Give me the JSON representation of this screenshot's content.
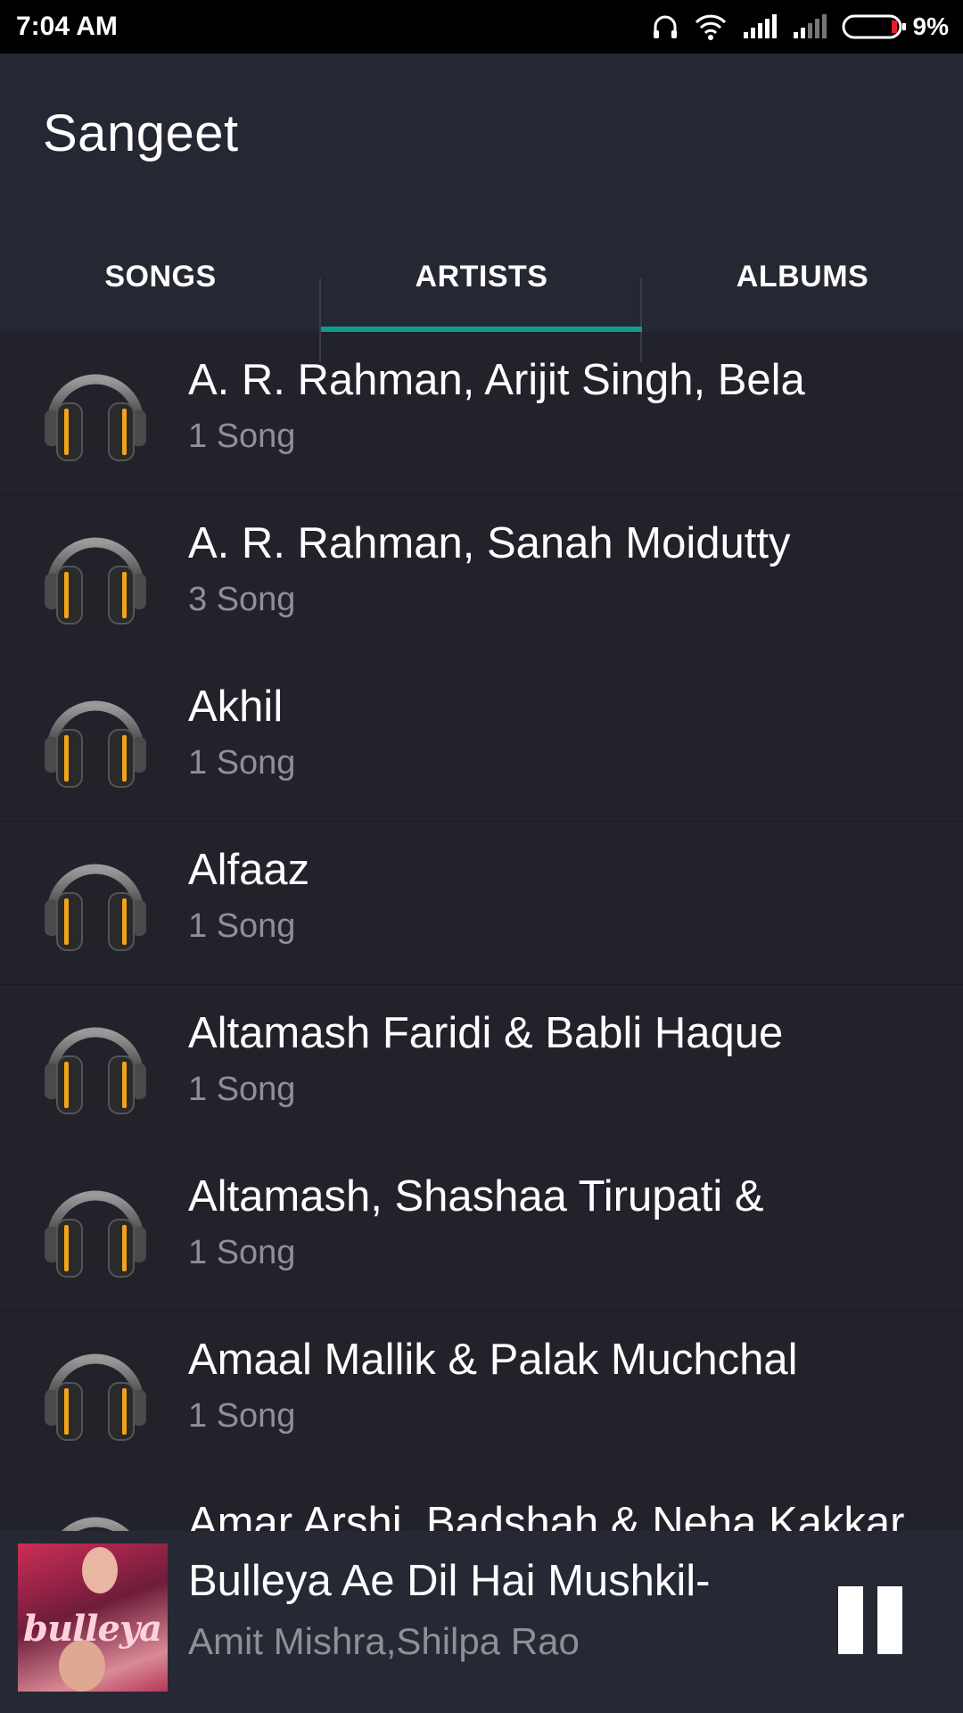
{
  "status_bar": {
    "time": "7:04 AM",
    "battery_percent": "9%",
    "icons": [
      "headphones-icon",
      "wifi-icon",
      "signal-icon",
      "signal-weak-icon",
      "battery-icon"
    ]
  },
  "app": {
    "title": "Sangeet"
  },
  "tabs": [
    {
      "label": "SONGS",
      "active": false
    },
    {
      "label": "ARTISTS",
      "active": true
    },
    {
      "label": "ALBUMS",
      "active": false
    }
  ],
  "artists": [
    {
      "name": "A. R. Rahman, Arijit Singh, Bela",
      "count": "1 Song"
    },
    {
      "name": "A. R. Rahman, Sanah Moidutty",
      "count": "3 Song"
    },
    {
      "name": "Akhil",
      "count": "1 Song"
    },
    {
      "name": "Alfaaz",
      "count": "1 Song"
    },
    {
      "name": "Altamash Faridi & Babli Haque",
      "count": "1 Song"
    },
    {
      "name": "Altamash, Shashaa Tirupati &",
      "count": "1 Song"
    },
    {
      "name": "Amaal Mallik & Palak Muchchal",
      "count": "1 Song"
    },
    {
      "name": "Amar Arshi, Badshah & Neha Kakkar",
      "count": ""
    }
  ],
  "now_playing": {
    "title": "Bulleya Ae Dil Hai Mushkil-",
    "artist": "Amit Mishra,Shilpa Rao",
    "cover_text": "bulleya",
    "pause_icon": "pause-icon"
  },
  "colors": {
    "background": "#22222b",
    "appbar": "#252732",
    "accent": "#0f9b8e",
    "secondary_text": "#8f8f97",
    "headphone_accent": "#f2a31b"
  }
}
